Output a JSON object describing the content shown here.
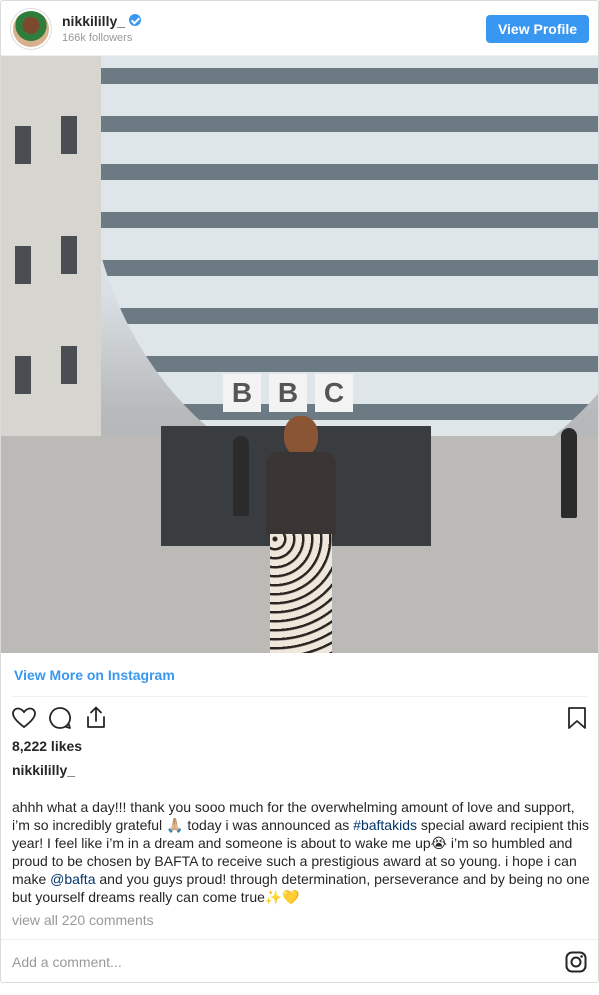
{
  "header": {
    "username": "nikkililly_",
    "followers": "166k followers",
    "view_profile_label": "View Profile",
    "verified_icon": "verified-badge-icon"
  },
  "post": {
    "image_icon": "post-photo",
    "view_more_label": "View More on Instagram",
    "likes": "8,222 likes",
    "caption_username": "nikkililly_",
    "caption": {
      "part1": "ahhh what a day!!! thank you sooo much for the overwhelming amount of love and support, i’m so incredibly grateful 🙏🏼 today i was announced as ",
      "hashtag": "#baftakids",
      "part2": " special award recipient this year! I feel like i’m in a dream and someone is about to wake me up😭 i’m so humbled and proud to be chosen by BAFTA to receive such a prestigious award at so young. i hope i can make ",
      "mention": "@bafta",
      "part3": " and you guys proud! through determination, perseverance and by being no one but yourself dreams really can come true✨💛"
    },
    "comments_label": "view all 220 comments",
    "comment_placeholder": "Add a comment...",
    "sign_text": [
      "B",
      "B",
      "C"
    ]
  },
  "colors": {
    "accent": "#3897f0",
    "link": "#003569",
    "muted": "#999999",
    "border": "#dbdbdb"
  }
}
